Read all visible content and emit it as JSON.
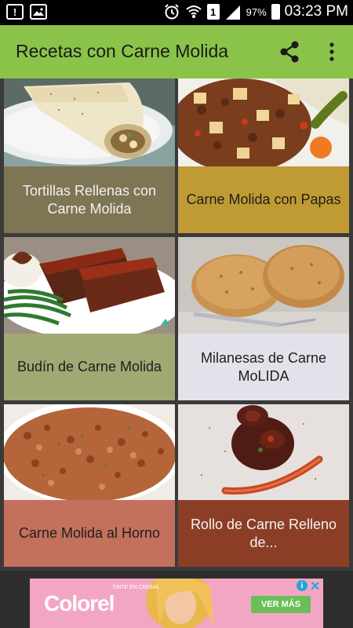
{
  "status_bar": {
    "battery": "97%",
    "time": "03:23 PM",
    "sim_label": "1",
    "notification_icon": "!"
  },
  "app_bar": {
    "title": "Recetas con Carne Molida",
    "icons": [
      "share-icon",
      "more-vert-icon"
    ]
  },
  "recipes": [
    {
      "title": "Tortillas Rellenas con Carne Molida",
      "caption_bg": "#7d7554",
      "caption_color": "#f2f2f2"
    },
    {
      "title": "Carne Molida con Papas",
      "caption_bg": "#c09a33",
      "caption_color": "#1e1e1e"
    },
    {
      "title": "Budín de Carne Molida",
      "caption_bg": "#a1a873",
      "caption_color": "#1e1e1e"
    },
    {
      "title": "Milanesas de Carne MoLIDA",
      "caption_bg": "#e2e2ea",
      "caption_color": "#1e1e1e"
    },
    {
      "title": "Carne Molida al Horno",
      "caption_bg": "#c3705c",
      "caption_color": "#1e1e1e"
    },
    {
      "title": "Rollo de Carne Relleno de...",
      "caption_bg": "#8b3e25",
      "caption_color": "#f2f2f2"
    }
  ],
  "ad": {
    "brand": "Colorel",
    "tagline": "TINTE EN CREMA",
    "cta": "VER MÁS",
    "info": "i",
    "close": "✕"
  }
}
